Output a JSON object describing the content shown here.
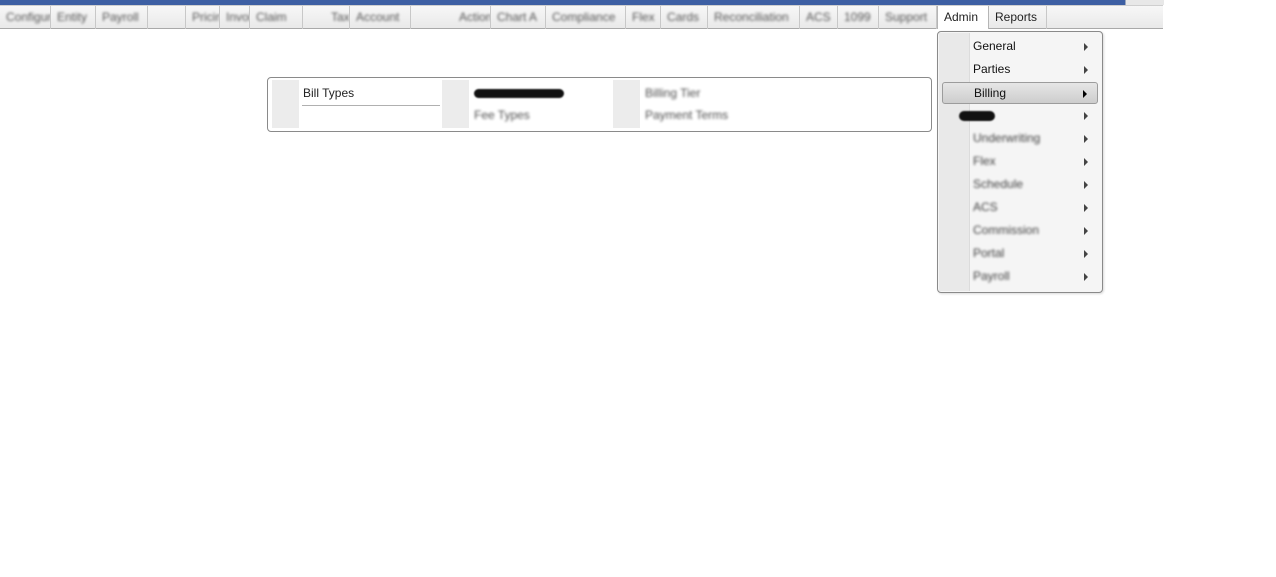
{
  "menubar": {
    "items": [
      {
        "label": "Configure",
        "blurred": true
      },
      {
        "label": "Entity",
        "blurred": true
      },
      {
        "label": "Payroll",
        "blurred": true
      },
      {
        "label": "Pricing",
        "blurred": true
      },
      {
        "label": "Invoice",
        "blurred": true
      },
      {
        "label": "Claim",
        "blurred": true
      },
      {
        "label": "Tax",
        "blurred": true
      },
      {
        "label": "Account",
        "blurred": true
      },
      {
        "label": "Action",
        "blurred": true
      },
      {
        "label": "Chart A",
        "blurred": true
      },
      {
        "label": "Compliance",
        "blurred": true
      },
      {
        "label": "Flex",
        "blurred": true
      },
      {
        "label": "Cards",
        "blurred": true
      },
      {
        "label": "Reconciliation",
        "blurred": true
      },
      {
        "label": "ACS",
        "blurred": true
      },
      {
        "label": "1099",
        "blurred": true
      },
      {
        "label": "Support",
        "blurred": true
      },
      {
        "label": "Admin",
        "blurred": false
      },
      {
        "label": "Reports",
        "blurred": false
      }
    ]
  },
  "admin_menu": {
    "items": [
      {
        "label": "General",
        "blurred": false
      },
      {
        "label": "Parties",
        "blurred": false
      },
      {
        "label": "Billing",
        "blurred": false,
        "highlighted": true
      },
      {
        "label": "",
        "blurred": true,
        "redacted": true
      },
      {
        "label": "Underwriting",
        "blurred": true
      },
      {
        "label": "Flex",
        "blurred": true
      },
      {
        "label": "Schedule",
        "blurred": true
      },
      {
        "label": "ACS",
        "blurred": true
      },
      {
        "label": "Commission",
        "blurred": true
      },
      {
        "label": "Portal",
        "blurred": true
      },
      {
        "label": "Payroll",
        "blurred": true
      }
    ]
  },
  "billing_submenu": {
    "col1": {
      "item1": "Bill Types"
    },
    "col2": {
      "item1": "",
      "item2": "Fee Types"
    },
    "col3": {
      "item1": "Billing Tier",
      "item2": "Payment Terms"
    }
  },
  "colors": {
    "title_strip": "#3d5fa3",
    "menubar_bg": "#eeeeee",
    "menu_border": "#8a8a8a"
  }
}
